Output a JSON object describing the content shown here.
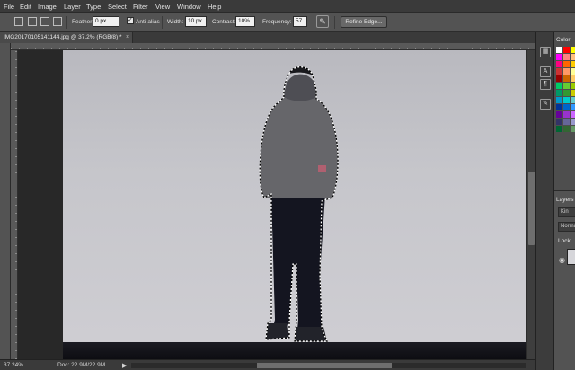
{
  "menubar": {
    "items": [
      "File",
      "Edit",
      "Image",
      "Layer",
      "Type",
      "Select",
      "Filter",
      "View",
      "Window",
      "Help"
    ]
  },
  "options": {
    "feather_label": "Feather:",
    "feather_value": "0 px",
    "antialias_label": "Anti-alias",
    "antialias_checked": true,
    "width_label": "Width:",
    "width_value": "10 px",
    "contrast_label": "Contrast:",
    "contrast_value": "10%",
    "frequency_label": "Frequency:",
    "frequency_value": "57",
    "refine_edge_label": "Refine Edge..."
  },
  "document": {
    "tab_title": "IMG20170105141144.jpg @ 37.2% (RGB/8) *",
    "close_glyph": "×"
  },
  "status": {
    "zoom": "37.24%",
    "doc_size": "Doc: 22.9M/22.9M",
    "arrow": "▶"
  },
  "panels": {
    "color_tab": "Color",
    "layers_tab": "Layers",
    "kind_label": "Kin",
    "blend_mode": "Norma",
    "lock_label": "Lock:"
  },
  "swatch_colors": [
    [
      "#ffffff",
      "#ff0000",
      "#ffff00"
    ],
    [
      "#ff00ff",
      "#ff8080",
      "#ffc080"
    ],
    [
      "#ff0080",
      "#ff6600",
      "#ffcc00"
    ],
    [
      "#cc3333",
      "#ff9966",
      "#ffff99"
    ],
    [
      "#990000",
      "#cc6600",
      "#ffcc66"
    ],
    [
      "#00cc66",
      "#66cc33",
      "#99cc00"
    ],
    [
      "#009966",
      "#339933",
      "#cccc00"
    ],
    [
      "#0099cc",
      "#00cccc",
      "#66cccc"
    ],
    [
      "#003399",
      "#0066cc",
      "#3399ff"
    ],
    [
      "#660099",
      "#9933cc",
      "#cc66ff"
    ],
    [
      "#333366",
      "#666699",
      "#9999cc"
    ],
    [
      "#006633",
      "#336633",
      "#669966"
    ]
  ],
  "colors": {
    "sky_top": "#b9b9bf",
    "sky_bottom": "#cfced3",
    "jacket": "#66666a",
    "pants": "#141520",
    "selection": "#ffffff"
  }
}
